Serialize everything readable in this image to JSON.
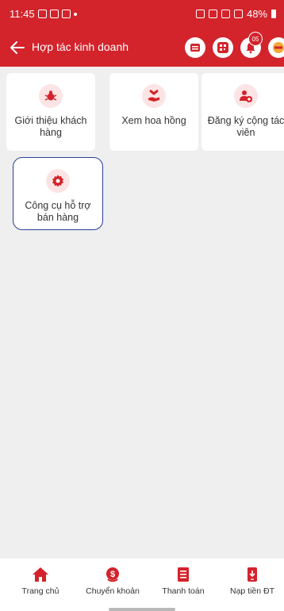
{
  "status_bar": {
    "time": "11:45",
    "battery": "48%"
  },
  "app_bar": {
    "title": "Hợp tác kinh doanh",
    "notification_count": "05"
  },
  "cards": [
    {
      "label": "Giới thiệu khách hàng",
      "icon": "user-bug-icon"
    },
    {
      "label": "Xem hoa hồng",
      "icon": "hand-heart-icon"
    },
    {
      "label": "Đăng ký cộng tác viên",
      "icon": "add-user-icon"
    },
    {
      "label": "Công cụ hỗ trợ bán hàng",
      "icon": "gear-icon"
    }
  ],
  "bottom_nav": [
    {
      "label": "Trang chủ",
      "icon": "home-icon"
    },
    {
      "label": "Chuyển khoản",
      "icon": "money-transfer-icon"
    },
    {
      "label": "Thanh toán",
      "icon": "bill-icon"
    },
    {
      "label": "Nạp tiền ĐT",
      "icon": "phone-topup-icon"
    }
  ],
  "colors": {
    "brand": "#d3232b",
    "selected_border": "#2a3e9a"
  }
}
